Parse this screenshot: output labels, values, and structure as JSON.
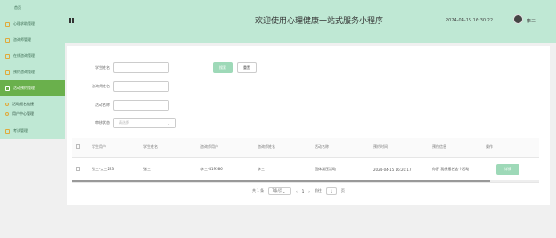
{
  "sidebar": {
    "items": [
      {
        "label": "首页"
      },
      {
        "label": "心理求助管理"
      },
      {
        "label": "咨询师管理"
      },
      {
        "label": "在线咨询管理"
      },
      {
        "label": "预约咨询管理"
      },
      {
        "label": "活动预约管理"
      },
      {
        "label": "活动报名链接"
      },
      {
        "label": "用户中心管理"
      },
      {
        "label": "考试管理"
      }
    ]
  },
  "header": {
    "title": "欢迎使用心理健康一站式服务小程序",
    "time": "2024-04-15 16:30:22",
    "username": "李三"
  },
  "form": {
    "fields": [
      {
        "label": "学生姓名",
        "value": ""
      },
      {
        "label": "咨询师姓名",
        "value": ""
      },
      {
        "label": "活动名称",
        "value": ""
      }
    ],
    "select": {
      "label": "审核状态",
      "placeholder": "请选择"
    },
    "search_label": "搜索",
    "reset_label": "重置"
  },
  "table": {
    "columns": [
      "学生用户",
      "学生姓名",
      "咨询师用户",
      "咨询师姓名",
      "活动名称",
      "预约时间",
      "预约信息",
      "操作"
    ],
    "rows": [
      {
        "cells": [
          "张三-大三223",
          "张三",
          "李三-419586",
          "李三",
          "团体减压活动",
          "2024-04-15 16:20:17",
          "你好 我想报名这个活动"
        ],
        "action": "详情"
      }
    ]
  },
  "pager": {
    "total": "共 1 条",
    "page_size": "7条/页",
    "prev": "‹",
    "current": "1",
    "next": "›",
    "goto_prefix": "前往",
    "goto_value": "1",
    "goto_suffix": "页"
  }
}
